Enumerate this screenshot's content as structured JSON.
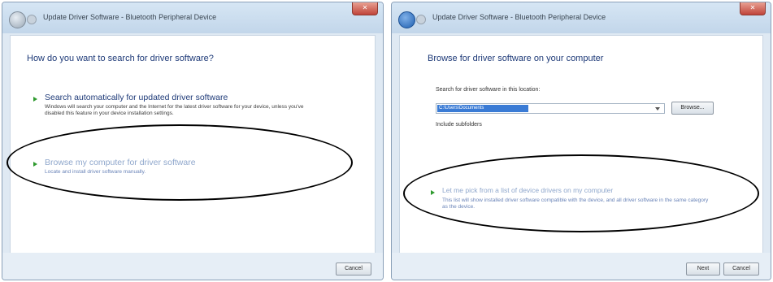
{
  "left_window": {
    "title": "Update Driver Software - Bluetooth Peripheral Device",
    "close": "✕",
    "heading": "How do you want to search for driver software?",
    "option1": {
      "title": "Search automatically for updated driver software",
      "desc": "Windows will search your computer and the Internet for the latest driver software for your device, unless you've disabled this feature in your device installation settings."
    },
    "option2": {
      "title": "Browse my computer for driver software",
      "desc": "Locate and install driver software manually."
    },
    "cancel": "Cancel"
  },
  "right_window": {
    "title": "Update Driver Software - Bluetooth Peripheral Device",
    "close": "✕",
    "heading": "Browse for driver software on your computer",
    "search_label": "Search for driver software in this location:",
    "path_value": "C:\\Users\\Documents",
    "browse": "Browse...",
    "include_subfolders": "Include subfolders",
    "option": {
      "title": "Let me pick from a list of device drivers on my computer",
      "desc": "This list will show installed driver software compatible with the device, and all driver software in the same category as the device."
    },
    "next": "Next",
    "cancel": "Cancel"
  }
}
